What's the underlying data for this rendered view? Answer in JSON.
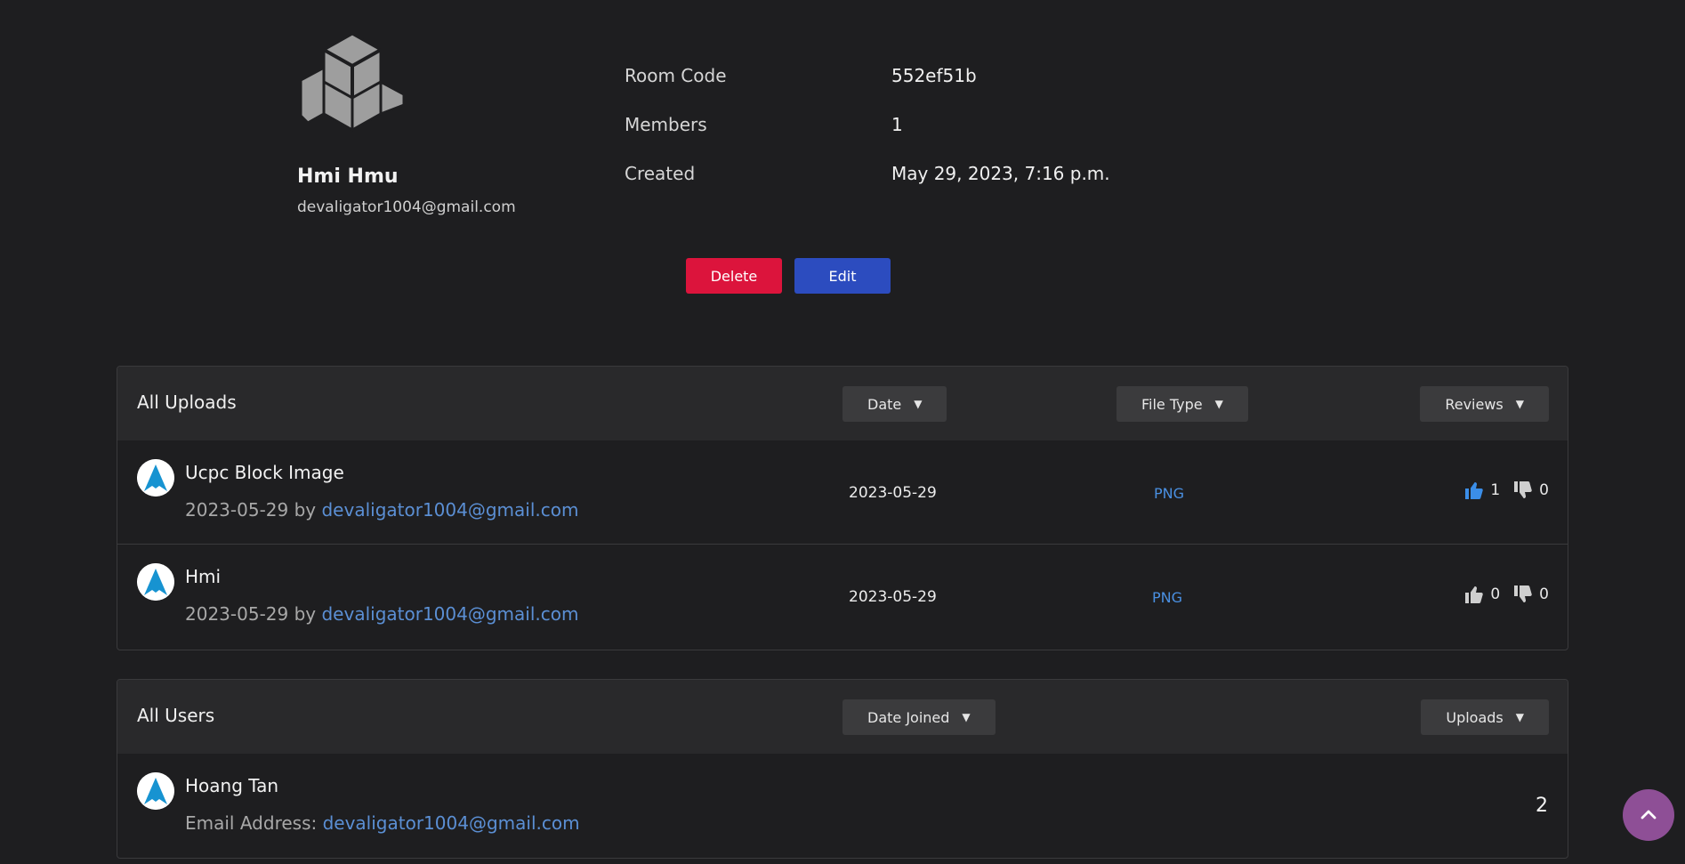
{
  "room": {
    "owner_name": "Hmi Hmu",
    "owner_email": "devaligator1004@gmail.com",
    "info": [
      {
        "label": "Room Code",
        "value": "552ef51b"
      },
      {
        "label": "Members",
        "value": "1"
      },
      {
        "label": "Created",
        "value": "May 29, 2023, 7:16 p.m."
      }
    ],
    "delete_label": "Delete",
    "edit_label": "Edit"
  },
  "uploads": {
    "title": "All Uploads",
    "sort_date": "Date",
    "sort_file_type": "File Type",
    "sort_reviews": "Reviews",
    "items": [
      {
        "title": "Ucpc Block Image",
        "date_by": "2023-05-29 by ",
        "author": "devaligator1004@gmail.com",
        "date": "2023-05-29",
        "type": "PNG",
        "likes": "1",
        "dislikes": "0",
        "liked": true
      },
      {
        "title": "Hmi",
        "date_by": "2023-05-29 by ",
        "author": "devaligator1004@gmail.com",
        "date": "2023-05-29",
        "type": "PNG",
        "likes": "0",
        "dislikes": "0",
        "liked": false
      }
    ]
  },
  "users": {
    "title": "All Users",
    "sort_date_joined": "Date Joined",
    "sort_uploads": "Uploads",
    "items": [
      {
        "name": "Hoang Tan",
        "email_label": "Email Address: ",
        "email": "devaligator1004@gmail.com",
        "uploads": "2"
      }
    ]
  },
  "colors": {
    "background": "#1e1e20",
    "delete": "#dc143c",
    "edit": "#2c4cbf",
    "link": "#5b8fd4",
    "like_active": "#3b8ee8",
    "scroll_top": "#8e4f96"
  },
  "icons": [
    "room-logo-icon",
    "avatar-icon",
    "thumbs-up-icon",
    "thumbs-down-icon",
    "chevron-up-icon"
  ]
}
